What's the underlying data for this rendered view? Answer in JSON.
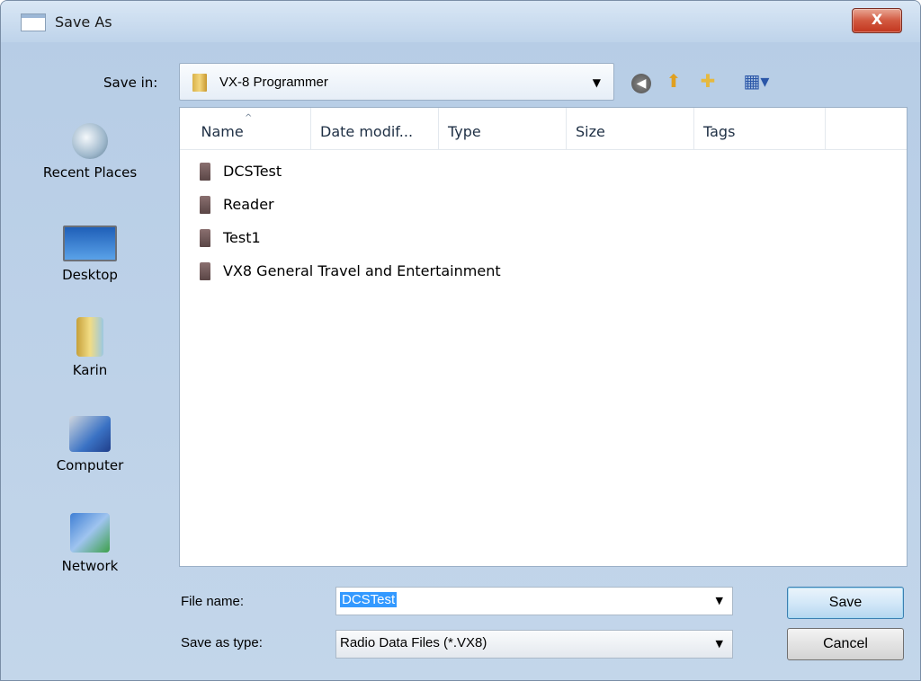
{
  "window": {
    "title": "Save As",
    "close_label": "X"
  },
  "toolbar": {
    "save_in_label": "Save in:",
    "save_in_value": "VX-8 Programmer",
    "icons": [
      "back-icon",
      "up-folder-icon",
      "new-folder-icon",
      "views-menu-icon"
    ]
  },
  "places": [
    {
      "label": "Recent Places",
      "icon": "recent-places-icon"
    },
    {
      "label": "Desktop",
      "icon": "desktop-icon"
    },
    {
      "label": "Karin",
      "icon": "user-folder-icon"
    },
    {
      "label": "Computer",
      "icon": "computer-icon"
    },
    {
      "label": "Network",
      "icon": "network-icon"
    }
  ],
  "columns": [
    "Name",
    "Date modif...",
    "Type",
    "Size",
    "Tags"
  ],
  "files": [
    {
      "name": "DCSTest"
    },
    {
      "name": "Reader"
    },
    {
      "name": "Test1"
    },
    {
      "name": "VX8 General Travel and Entertainment"
    }
  ],
  "form": {
    "file_name_label": "File name:",
    "file_name_value": "DCSTest",
    "save_type_label": "Save as type:",
    "save_type_value": "Radio Data Files (*.VX8)"
  },
  "buttons": {
    "save": "Save",
    "cancel": "Cancel"
  },
  "colors": {
    "selection": "#3399ff",
    "close_button": "#c2361e"
  }
}
